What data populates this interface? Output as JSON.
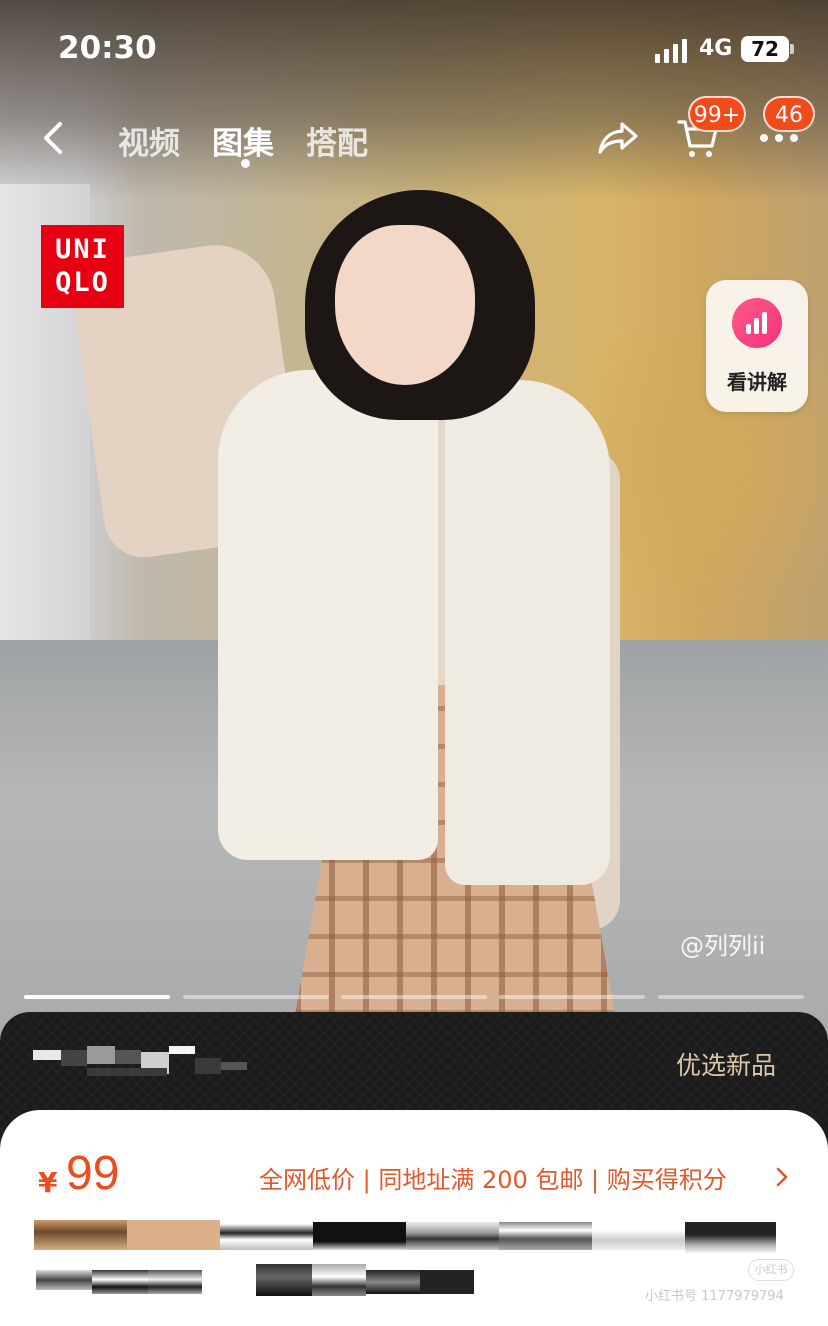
{
  "status_bar": {
    "time": "20:30",
    "network": "4G",
    "battery": "72"
  },
  "nav": {
    "tabs": [
      {
        "label": "视频",
        "active": false
      },
      {
        "label": "图集",
        "active": true
      },
      {
        "label": "搭配",
        "active": false
      }
    ],
    "cart_badge": "99+",
    "more_badge": "46"
  },
  "brand_logo": {
    "line1": "UNI",
    "line2": "QLO"
  },
  "explain_button": {
    "label": "看讲解"
  },
  "photo_credit": "@列列ii",
  "carousel": {
    "total": 5,
    "active_index": 0
  },
  "strip": {
    "label": "优选新品"
  },
  "product": {
    "currency": "¥",
    "price": "99",
    "promo": "全网低价 | 同地址满 200 包邮 | 购买得积分"
  },
  "footer": {
    "watermark": "小红书号 1177979794",
    "logo_text": "小红书"
  },
  "colors": {
    "accent": "#ea4d1f",
    "badge": "#f14a1b",
    "logo_red": "#e60012"
  },
  "icons": [
    "back-icon",
    "share-icon",
    "cart-icon",
    "more-icon",
    "chart-icon",
    "chevron-right-icon"
  ]
}
